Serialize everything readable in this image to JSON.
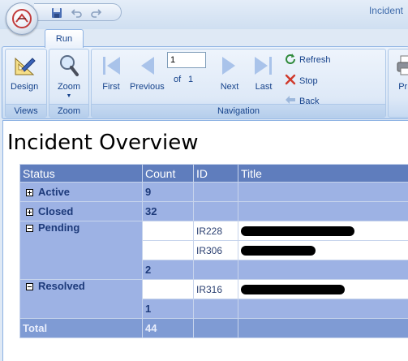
{
  "window": {
    "title": "Incident"
  },
  "ribbon": {
    "tabs": [
      {
        "label": "Run"
      }
    ],
    "groups": {
      "views": {
        "label": "Views",
        "design_label": "Design"
      },
      "zoom": {
        "label": "Zoom",
        "zoom_label": "Zoom"
      },
      "navigation": {
        "label": "Navigation",
        "first_label": "First",
        "previous_label": "Previous",
        "page_value": "1",
        "of_label": "of",
        "total_pages": "1",
        "next_label": "Next",
        "last_label": "Last",
        "refresh_label": "Refresh",
        "stop_label": "Stop",
        "back_label": "Back"
      },
      "print": {
        "label": "Prin"
      }
    }
  },
  "report": {
    "title": "Incident Overview",
    "columns": [
      "Status",
      "Count",
      "ID",
      "Title"
    ],
    "groups": [
      {
        "status": "Active",
        "expanded": false,
        "count": "9"
      },
      {
        "status": "Closed",
        "expanded": false,
        "count": "32"
      },
      {
        "status": "Pending",
        "expanded": true,
        "count": "2",
        "items": [
          {
            "id": "IR228"
          },
          {
            "id": "IR306"
          }
        ]
      },
      {
        "status": "Resolved",
        "expanded": true,
        "count": "1",
        "items": [
          {
            "id": "IR316"
          }
        ]
      }
    ],
    "total": {
      "label": "Total",
      "count": "44"
    }
  },
  "colors": {
    "header_bg": "#5f7dbd",
    "group_bg": "#9db2e4",
    "total_bg": "#7f9bd4",
    "ribbon_text": "#15428b"
  },
  "icons": [
    "office-orb-icon",
    "save-icon",
    "undo-icon",
    "redo-icon",
    "design-icon",
    "zoom-icon",
    "first-page-icon",
    "previous-page-icon",
    "next-page-icon",
    "last-page-icon",
    "refresh-icon",
    "stop-icon",
    "back-icon",
    "print-icon",
    "collapse-icon",
    "expand-icon"
  ]
}
